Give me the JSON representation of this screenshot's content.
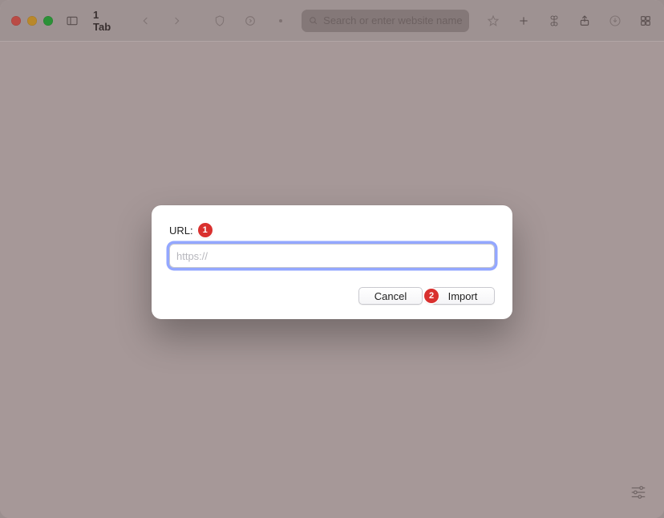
{
  "toolbar": {
    "tab_label": "1 Tab",
    "address_placeholder": "Search or enter website name"
  },
  "dialog": {
    "label": "URL:",
    "placeholder": "https://",
    "value": "",
    "cancel_label": "Cancel",
    "import_label": "Import"
  },
  "annotations": {
    "step1": "1",
    "step2": "2"
  }
}
